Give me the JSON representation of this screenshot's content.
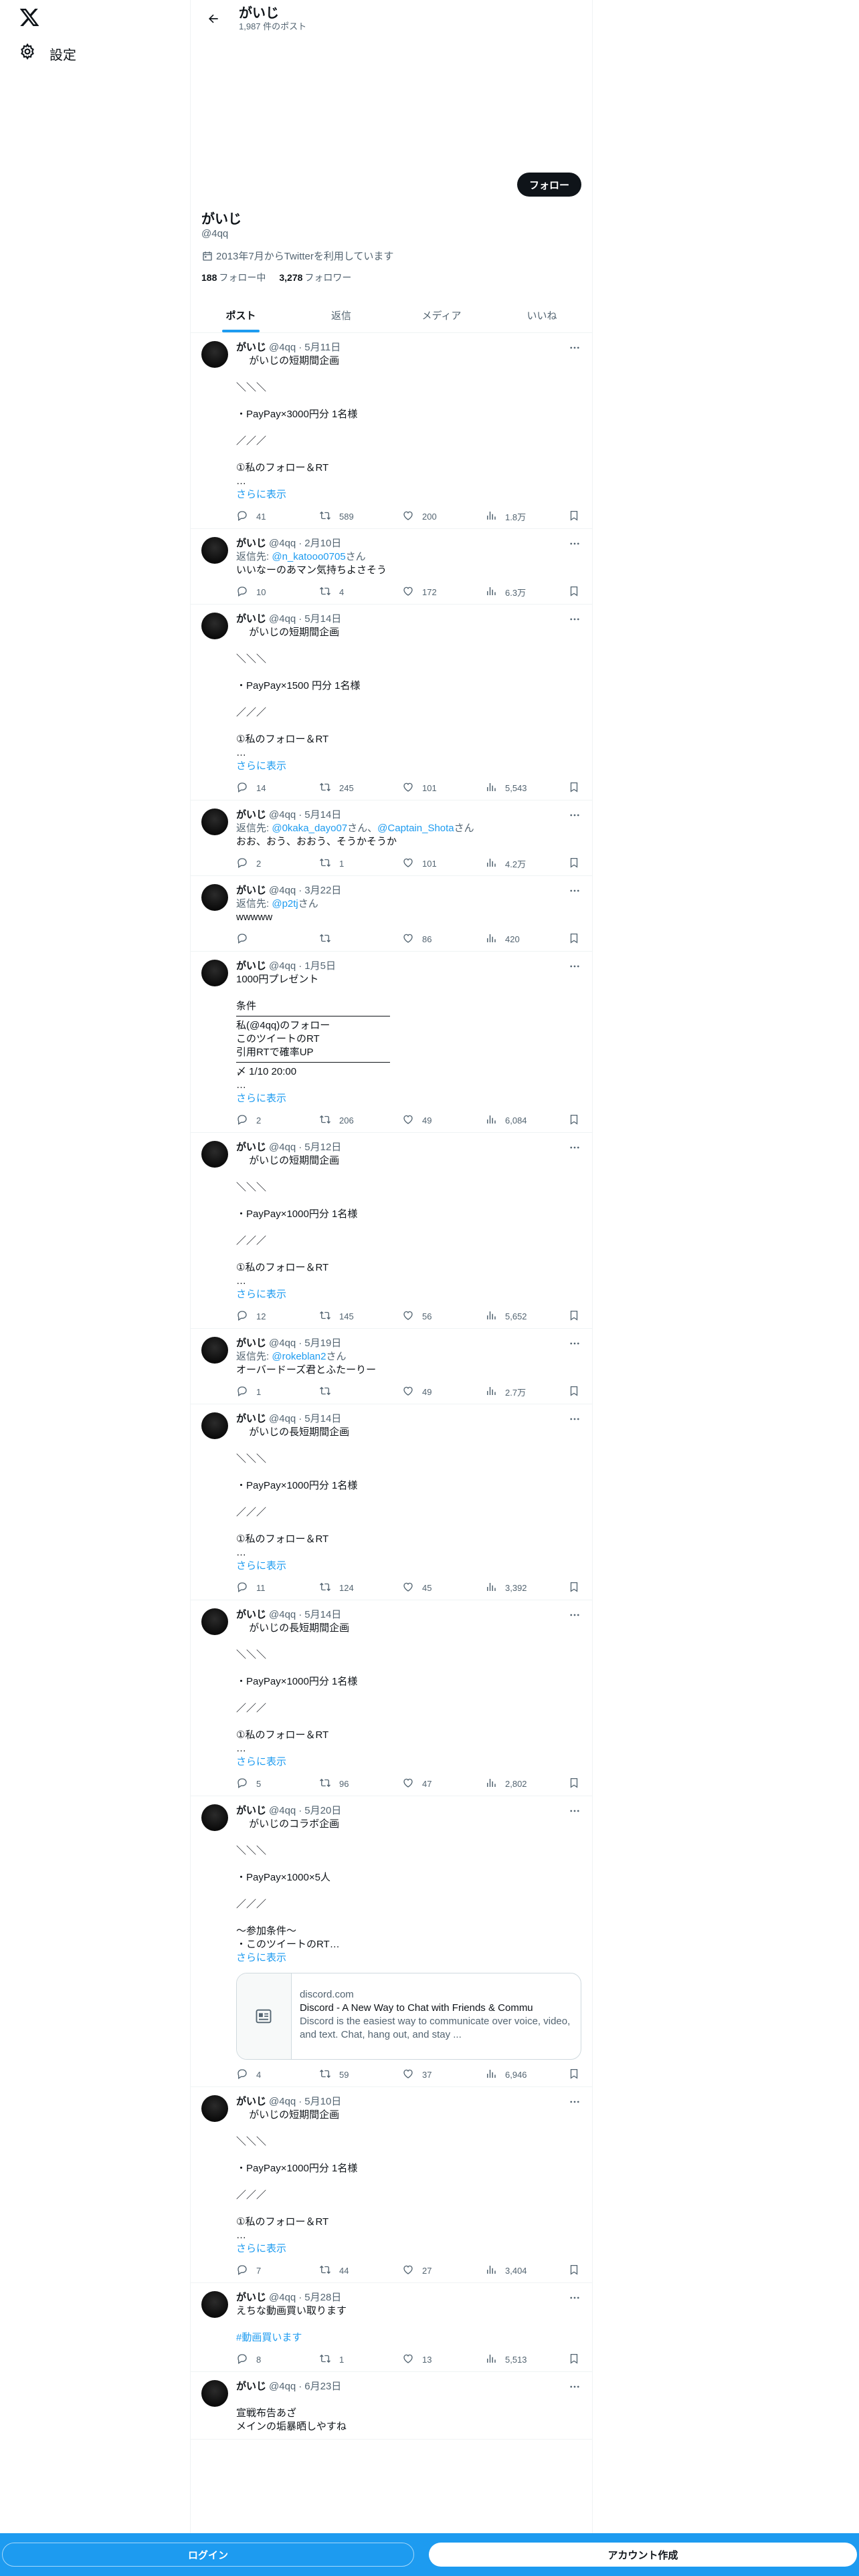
{
  "nav": {
    "settings_label": "設定"
  },
  "header": {
    "title": "がいじ",
    "post_count": "1,987 件のポスト"
  },
  "profile": {
    "display_name": "がいじ",
    "handle": "@4qq",
    "joined": "2013年7月からTwitterを利用しています",
    "following_count": "188",
    "following_label": "フォロー中",
    "followers_count": "3,278",
    "followers_label": "フォロワー",
    "follow_button": "フォロー"
  },
  "tabs": [
    "ポスト",
    "返信",
    "メディア",
    "いいね"
  ],
  "show_more_label": "さらに表示",
  "tweets": [
    {
      "name": "がいじ",
      "handle": "@4qq",
      "date": "5月11日",
      "lines": [
        "　 がいじの短期間企画",
        "",
        "＼＼＼",
        "",
        "・PayPay×3000円分 1名様",
        "",
        "／／／",
        "",
        "①私のフォロー＆RT",
        "…"
      ],
      "replies": "41",
      "retweets": "589",
      "likes": "200",
      "views": "1.8万"
    },
    {
      "name": "がいじ",
      "handle": "@4qq",
      "date": "2月10日",
      "reply_prefix": "返信先: ",
      "reply_to": "@n_katooo0705",
      "reply_suffix": "さん",
      "lines": [
        "いいなーのあマン気持ちよさそう"
      ],
      "replies": "10",
      "retweets": "4",
      "likes": "172",
      "views": "6.3万"
    },
    {
      "name": "がいじ",
      "handle": "@4qq",
      "date": "5月14日",
      "lines": [
        "　 がいじの短期間企画",
        "",
        "＼＼＼",
        "",
        "・PayPay×1500 円分 1名様",
        "",
        "／／／",
        "",
        "①私のフォロー＆RT",
        "…"
      ],
      "replies": "14",
      "retweets": "245",
      "likes": "101",
      "views": "5,543"
    },
    {
      "name": "がいじ",
      "handle": "@4qq",
      "date": "5月14日",
      "reply_prefix": "返信先: ",
      "reply_to": "@0kaka_dayo07",
      "reply_mid": "さん、",
      "reply_to2": "@Captain_Shota",
      "reply_suffix": "さん",
      "lines": [
        "おお、おう、おおう、そうかそうか"
      ],
      "replies": "2",
      "retweets": "1",
      "likes": "101",
      "views": "4.2万"
    },
    {
      "name": "がいじ",
      "handle": "@4qq",
      "date": "3月22日",
      "reply_prefix": "返信先: ",
      "reply_to": "@p2tj",
      "reply_suffix": "さん",
      "lines": [
        "wwwww"
      ],
      "replies": "",
      "retweets": "",
      "likes": "86",
      "views": "420"
    },
    {
      "name": "がいじ",
      "handle": "@4qq",
      "date": "1月5日",
      "lines": [
        "1000円プレゼント",
        "",
        "条件"
      ],
      "lines2": [
        "私(@4qq)のフォロー",
        "このツイートのRT",
        "引用RTで確率UP"
      ],
      "lines3": [
        "〆 1/10 20:00",
        "…"
      ],
      "replies": "2",
      "retweets": "206",
      "likes": "49",
      "views": "6,084"
    },
    {
      "name": "がいじ",
      "handle": "@4qq",
      "date": "5月12日",
      "lines": [
        "　 がいじの短期間企画",
        "",
        "＼＼＼",
        "",
        "・PayPay×1000円分 1名様",
        "",
        "／／／",
        "",
        "①私のフォロー＆RT",
        "…"
      ],
      "replies": "12",
      "retweets": "145",
      "likes": "56",
      "views": "5,652"
    },
    {
      "name": "がいじ",
      "handle": "@4qq",
      "date": "5月19日",
      "reply_prefix": "返信先: ",
      "reply_to": "@rokeblan2",
      "reply_suffix": "さん",
      "lines": [
        "オーバードーズ君とふたーりー"
      ],
      "replies": "1",
      "retweets": "",
      "likes": "49",
      "views": "2.7万"
    },
    {
      "name": "がいじ",
      "handle": "@4qq",
      "date": "5月14日",
      "lines": [
        "　 がいじの長短期間企画",
        "",
        "＼＼＼",
        "",
        "・PayPay×1000円分 1名様",
        "",
        "／／／",
        "",
        "①私のフォロー＆RT",
        "…"
      ],
      "replies": "11",
      "retweets": "124",
      "likes": "45",
      "views": "3,392"
    },
    {
      "name": "がいじ",
      "handle": "@4qq",
      "date": "5月14日",
      "lines": [
        "　 がいじの長短期間企画",
        "",
        "＼＼＼",
        "",
        "・PayPay×1000円分 1名様",
        "",
        "／／／",
        "",
        "①私のフォロー＆RT",
        "…"
      ],
      "replies": "5",
      "retweets": "96",
      "likes": "47",
      "views": "2,802"
    },
    {
      "name": "がいじ",
      "handle": "@4qq",
      "date": "5月20日",
      "lines": [
        "　 がいじのコラボ企画",
        "",
        "＼＼＼",
        "",
        "・PayPay×1000×5人",
        "",
        "／／／",
        "",
        "〜参加条件〜",
        "・このツイートのRT…"
      ],
      "card": {
        "domain": "discord.com",
        "title": "Discord - A New Way to Chat with Friends & Commu",
        "desc": "Discord is the easiest way to communicate over voice, video, and text. Chat, hang out, and stay ..."
      },
      "replies": "4",
      "retweets": "59",
      "likes": "37",
      "views": "6,946"
    },
    {
      "name": "がいじ",
      "handle": "@4qq",
      "date": "5月10日",
      "lines": [
        "　 がいじの短期間企画",
        "",
        "＼＼＼",
        "",
        "・PayPay×1000円分 1名様",
        "",
        "／／／",
        "",
        "①私のフォロー＆RT",
        "…"
      ],
      "replies": "7",
      "retweets": "44",
      "likes": "27",
      "views": "3,404"
    },
    {
      "name": "がいじ",
      "handle": "@4qq",
      "date": "5月28日",
      "lines": [
        "えちな動画買い取ります",
        ""
      ],
      "hashtag": "#動画買います",
      "replies": "8",
      "retweets": "1",
      "likes": "13",
      "views": "5,513"
    },
    {
      "name": "がいじ",
      "handle": "@4qq",
      "date": "6月23日",
      "lines": [
        "",
        "宣戦布告あざ",
        "メインの垢暴晒しやすね"
      ],
      "replies": "",
      "retweets": "",
      "likes": "",
      "views": ""
    }
  ],
  "bottom": {
    "login": "ログイン",
    "signup": "アカウント作成"
  }
}
